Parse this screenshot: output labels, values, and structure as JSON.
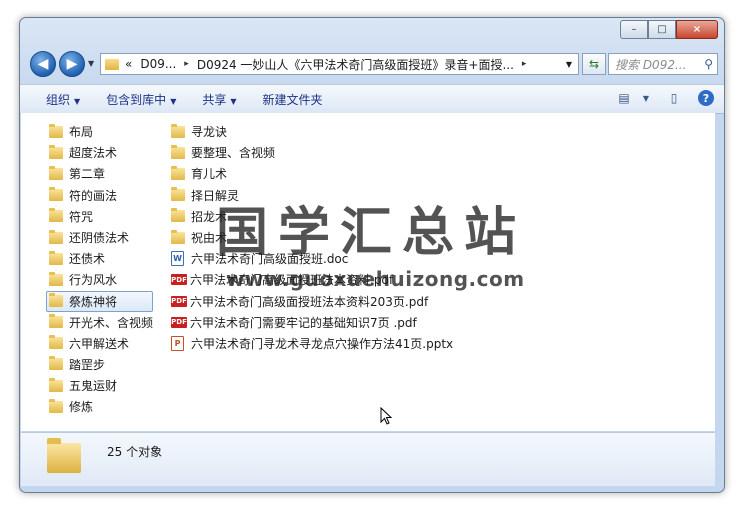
{
  "window": {
    "controls": {
      "minimize": "–",
      "maximize": "□",
      "close": "×"
    }
  },
  "nav": {
    "back": "◀",
    "forward": "▶",
    "dropdown": "▼"
  },
  "address": {
    "overflow": "«",
    "parts": [
      "D09...",
      "D0924 一妙山人《六甲法术奇门高级面授班》录音+面授..."
    ],
    "separator": "▸",
    "dropdown": "▼"
  },
  "refresh": {
    "icon": "refresh-icon",
    "glyph": "⇆"
  },
  "search": {
    "placeholder": "搜索 D092...",
    "glyph": "⚲"
  },
  "toolbar": {
    "organize": "组织",
    "include_in_library": "包含到库中",
    "share": "共享",
    "new_folder": "新建文件夹",
    "caret": "▼",
    "view_glyph": "▤",
    "pane_glyph": "▯",
    "help_glyph": "?"
  },
  "folders_col1": [
    {
      "label": "布局"
    },
    {
      "label": "超度法术"
    },
    {
      "label": "第二章"
    },
    {
      "label": "符的画法"
    },
    {
      "label": "符咒"
    },
    {
      "label": "还阴债法术"
    },
    {
      "label": "还债术"
    },
    {
      "label": "行为风水"
    },
    {
      "label": "祭炼神将"
    },
    {
      "label": "开光术、含视频"
    },
    {
      "label": "六甲解送术"
    },
    {
      "label": "踏罡步"
    },
    {
      "label": "五鬼运财"
    },
    {
      "label": "修炼"
    }
  ],
  "folders_col2": [
    {
      "label": "寻龙诀"
    },
    {
      "label": "要整理、含视频"
    },
    {
      "label": "育儿术"
    },
    {
      "label": "择日解灵"
    },
    {
      "label": "招龙术"
    },
    {
      "label": "祝由术"
    }
  ],
  "files": [
    {
      "label": "六甲法术奇门高级面授班.doc",
      "type": "doc",
      "badge": "W"
    },
    {
      "label": "六甲法术奇门高级面授班法本资料.pdf",
      "type": "pdf",
      "badge": "PDF"
    },
    {
      "label": "六甲法术奇门高级面授班法本资料203页.pdf",
      "type": "pdf",
      "badge": "PDF"
    },
    {
      "label": "六甲法术奇门需要牢记的基础知识7页 .pdf",
      "type": "pdf",
      "badge": "PDF"
    },
    {
      "label": "六甲法术奇门寻龙术寻龙点穴操作方法41页.pptx",
      "type": "pptx",
      "badge": "P"
    }
  ],
  "status": {
    "count_text": "25 个对象"
  },
  "watermark": {
    "title": "国学汇总站",
    "url": "www.guoxuehuizong.com"
  },
  "colors": {
    "toolbar_text": "#1e3287",
    "selection_border": "#7da2ce",
    "folder": "#e2b849",
    "pdf": "#c8201e"
  }
}
